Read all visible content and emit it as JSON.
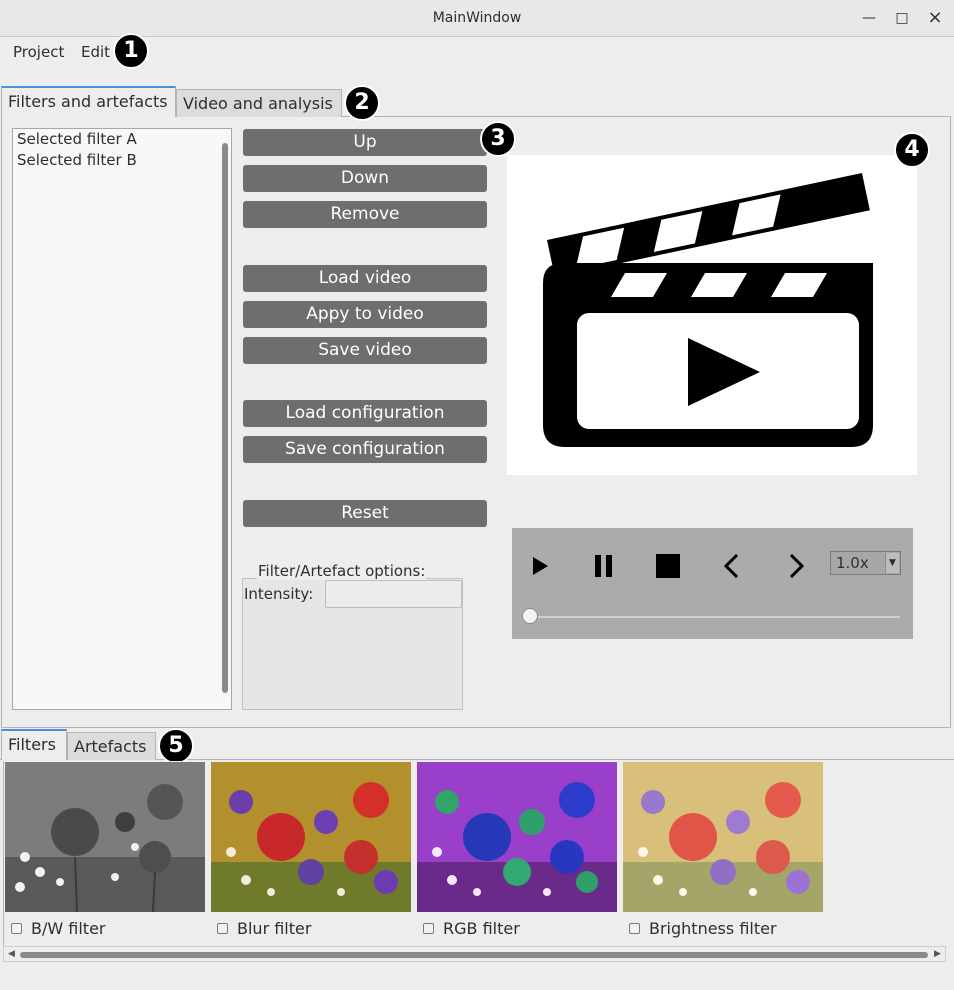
{
  "window": {
    "title": "MainWindow",
    "minimize_glyph": "—",
    "maximize_glyph": "□",
    "close_glyph": "×"
  },
  "menu": {
    "project": "Project",
    "edit": "Edit"
  },
  "badges": [
    "1",
    "2",
    "3",
    "4",
    "5"
  ],
  "main_tabs": {
    "filters": "Filters and artefacts",
    "video": "Video and analysis"
  },
  "selected_list": [
    "Selected filter A",
    "Selected filter B"
  ],
  "buttons": {
    "up": "Up",
    "down": "Down",
    "remove": "Remove",
    "load_video": "Load video",
    "apply_video": "Appy to video",
    "save_video": "Save video",
    "load_config": "Load configuration",
    "save_config": "Save configuration",
    "reset": "Reset"
  },
  "options": {
    "title": "Filter/Artefact options:",
    "intensity_label": "Intensity:",
    "intensity_value": ""
  },
  "video": {
    "icon": "clapperboard-play-icon"
  },
  "controls": {
    "speed": "1.0x",
    "progress": 0,
    "icons": [
      "play-icon",
      "pause-icon",
      "stop-icon",
      "previous-icon",
      "next-icon"
    ]
  },
  "bottom_tabs": {
    "filters": "Filters",
    "artefacts": "Artefacts"
  },
  "filters": [
    {
      "label": "B/W filter",
      "checked": false
    },
    {
      "label": "Blur filter",
      "checked": false
    },
    {
      "label": "RGB filter",
      "checked": false
    },
    {
      "label": "Brightness filter",
      "checked": false
    }
  ],
  "colors": {
    "button_bg": "#6e6e6e",
    "controls_bg": "#ababab",
    "tab_accent": "#4a90d9"
  }
}
